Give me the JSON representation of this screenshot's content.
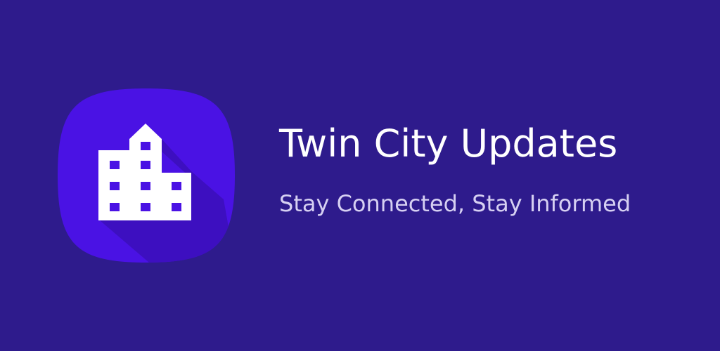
{
  "banner": {
    "title": "Twin City Updates",
    "tagline": "Stay Connected, Stay Informed"
  },
  "icon": {
    "name": "building-icon",
    "shape": "squircle"
  },
  "colors": {
    "background": "#2e1b8c",
    "icon_tile": "#4a12e4",
    "icon_shadow": "#3a0fb4",
    "building": "#ffffff",
    "windows": "#4a12e4",
    "title": "#ffffff",
    "tagline": "#d6d0f2"
  }
}
